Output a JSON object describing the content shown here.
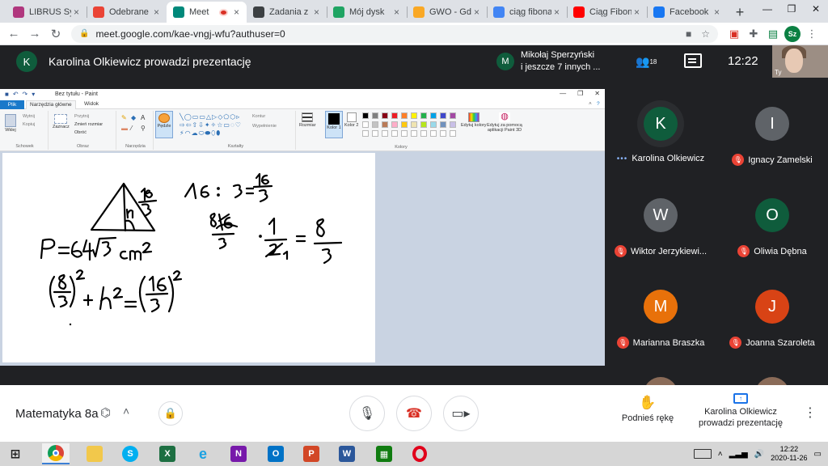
{
  "browser": {
    "tabs": [
      {
        "title": "LIBRUS Syn",
        "icon": "librus-icon",
        "color": "#b0377e"
      },
      {
        "title": "Odebrane",
        "icon": "gmail-icon",
        "color": "#ea4335"
      },
      {
        "title": "Meet",
        "icon": "meet-icon",
        "color": "#00897b",
        "active": true
      },
      {
        "title": "Zadania z",
        "icon": "classroom-icon",
        "color": "#3c4043"
      },
      {
        "title": "Mój dysk",
        "icon": "drive-icon",
        "color": "#1fa463"
      },
      {
        "title": "GWO - Gd",
        "icon": "gwo-icon",
        "color": "#f9a825"
      },
      {
        "title": "ciąg fibona",
        "icon": "google-icon",
        "color": "#4285f4"
      },
      {
        "title": "Ciąg Fibon",
        "icon": "youtube-icon",
        "color": "#ff0000"
      },
      {
        "title": "Facebook",
        "icon": "facebook-icon",
        "color": "#1877f2"
      }
    ],
    "url": "meet.google.com/kae-vngj-wfu?authuser=0",
    "profile_initials": "Sz"
  },
  "meet": {
    "presenter_initial": "K",
    "presenting_title": "Karolina Olkiewicz prowadzi prezentację",
    "others_initial": "M",
    "others_line1": "Mikołaj Sperzyński",
    "others_line2": "i jeszcze 7 innych ...",
    "participant_count": "18",
    "time": "12:22",
    "self_label": "Ty",
    "participants": [
      {
        "initial": "K",
        "name": "Karolina Olkiewicz",
        "color": "#0f5c3c",
        "muted": false
      },
      {
        "initial": "I",
        "name": "Ignacy Zamelski",
        "color": "#5f6368",
        "muted": true
      },
      {
        "initial": "W",
        "name": "Wiktor Jerzykiewi...",
        "color": "#5f6368",
        "muted": true
      },
      {
        "initial": "O",
        "name": "Oliwia Dębna",
        "color": "#0f5c3c",
        "muted": true
      },
      {
        "initial": "M",
        "name": "Marianna Braszka",
        "color": "#e8710a",
        "muted": true
      },
      {
        "initial": "J",
        "name": "Joanna Szaroleta",
        "color": "#d84315",
        "muted": true
      }
    ],
    "meeting_name": "Matematyka 8a",
    "raise_hand_label": "Podnieś rękę",
    "presenting_label_line1": "Karolina Olkiewicz",
    "presenting_label_line2": "prowadzi prezentację"
  },
  "paint": {
    "window_title": "Bez tytułu - Paint",
    "tab_file": "Plik",
    "tab_home": "Narzędzia główne",
    "tab_view": "Widok",
    "paste": "Wklej",
    "cut": "Wytnij",
    "copy": "Kopiuj",
    "select": "Zaznacz",
    "crop": "Przytnij",
    "resize": "Zmień rozmiar",
    "rotate": "Obróć",
    "brushes": "Pędzle",
    "outline": "Kontur",
    "fill": "Wypełnienie",
    "size": "Rozmiar",
    "color1": "Kolor 1",
    "color2": "Kolor 2",
    "edit_colors": "Edytuj kolory",
    "paint3d": "Edytuj za pomocą aplikacji Paint 3D",
    "group_clipboard": "Schowek",
    "group_image": "Obraz",
    "group_tools": "Narzędzia",
    "group_shapes": "Kształty",
    "group_colors": "Kolory",
    "palette": [
      "#000000",
      "#7f7f7f",
      "#880015",
      "#ed1c24",
      "#ff7f27",
      "#fff200",
      "#22b14c",
      "#00a2e8",
      "#3f48cc",
      "#a349a4",
      "#ffffff",
      "#c3c3c3",
      "#b97a57",
      "#ffaec9",
      "#ffc90e",
      "#efe4b0",
      "#b5e61d",
      "#99d9ea",
      "#7092be",
      "#c8bfe7"
    ]
  },
  "taskbar": {
    "time": "12:22",
    "date": "2020-11-26"
  }
}
